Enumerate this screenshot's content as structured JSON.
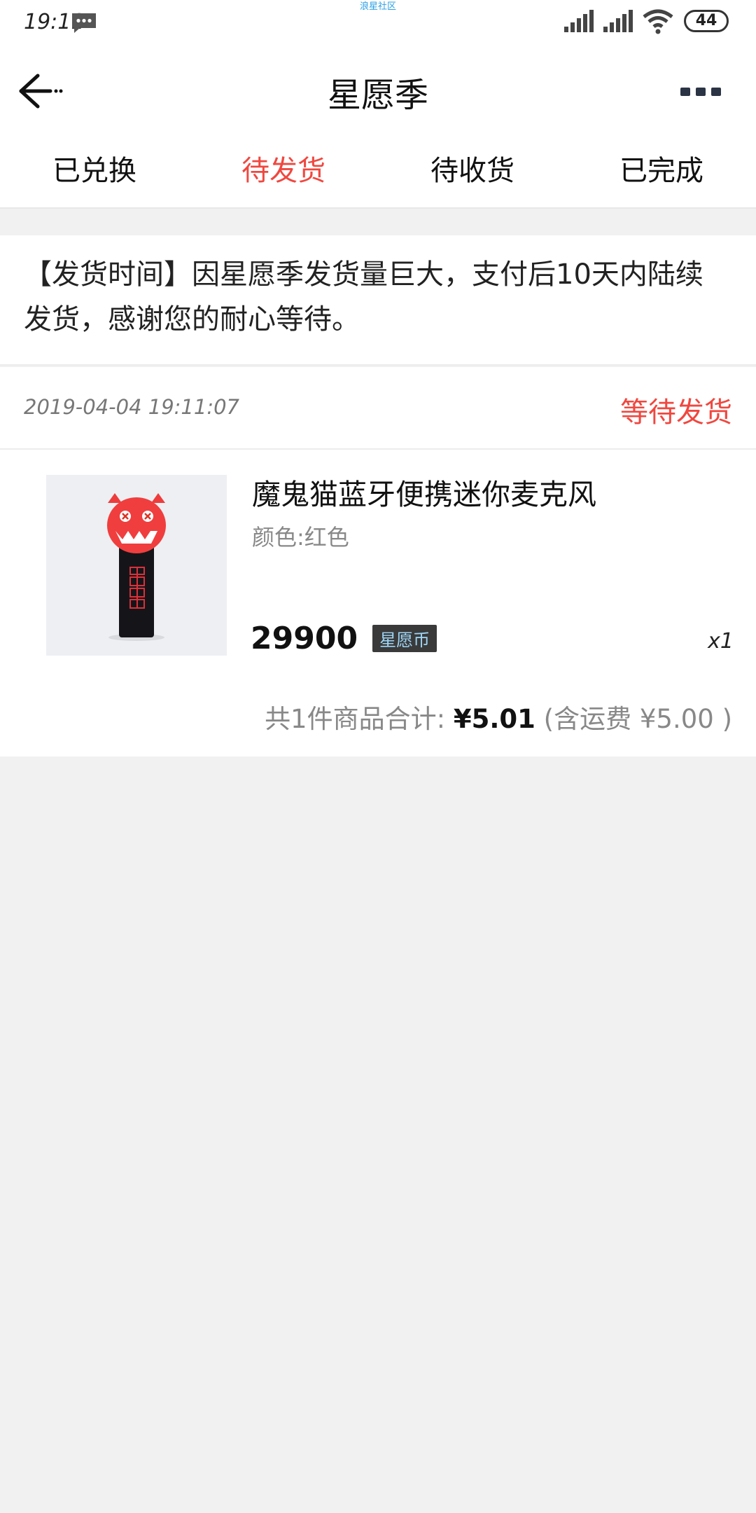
{
  "status_bar": {
    "time": "19:11",
    "center_text": "浪星社区",
    "battery": "44"
  },
  "header": {
    "title": "星愿季"
  },
  "tabs": [
    {
      "label": "已兑换",
      "active": false
    },
    {
      "label": "待发货",
      "active": true
    },
    {
      "label": "待收货",
      "active": false
    },
    {
      "label": "已完成",
      "active": false
    }
  ],
  "notice": {
    "text": "【发货时间】因星愿季发货量巨大，支付后10天内陆续发货，感谢您的耐心等待。"
  },
  "order": {
    "time": "2019-04-04 19:11:07",
    "status": "等待发货",
    "product": {
      "name": "魔鬼猫蓝牙便携迷你麦克风",
      "attribute": "颜色:红色",
      "price": "29900",
      "currency_badge": "星愿币",
      "quantity": "x1"
    },
    "summary": {
      "prefix": "共1件商品合计:",
      "total": "¥5.01",
      "shipping_open": "(含运费",
      "shipping": "¥5.00",
      "shipping_close": ")"
    }
  },
  "colors": {
    "accent": "#f0473f",
    "background": "#f1f1f1",
    "badge_bg": "#3a3a3a",
    "badge_text": "#9ed6f7"
  }
}
